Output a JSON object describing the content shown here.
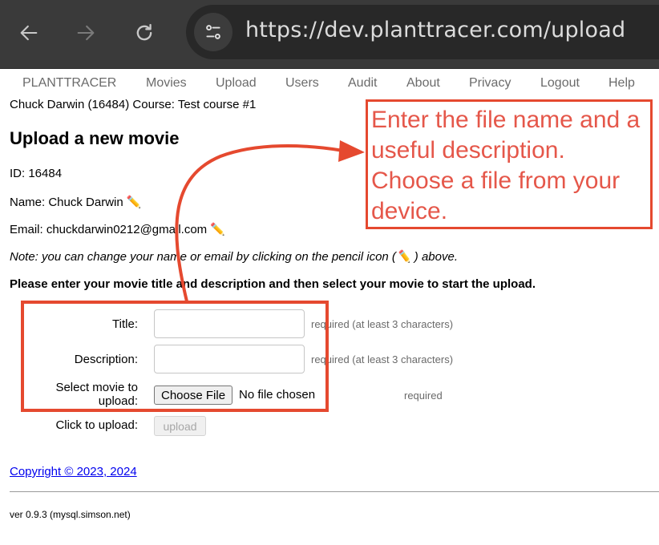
{
  "browser": {
    "url": "https://dev.planttracer.com/upload",
    "icons": {
      "back": "arrow-left-icon",
      "forward": "arrow-right-icon",
      "reload": "reload-icon",
      "site_info": "tune-icon"
    }
  },
  "nav": {
    "items": [
      {
        "label": "PLANTTRACER"
      },
      {
        "label": "Movies"
      },
      {
        "label": "Upload"
      },
      {
        "label": "Users"
      },
      {
        "label": "Audit"
      },
      {
        "label": "About"
      },
      {
        "label": "Privacy"
      },
      {
        "label": "Logout"
      },
      {
        "label": "Help"
      }
    ]
  },
  "user_line": "Chuck Darwin (16484) Course: Test course #1",
  "page": {
    "title": "Upload a new movie",
    "id_line": "ID: 16484",
    "name_line": "Name: Chuck Darwin",
    "email_line": "Email: chuckdarwin0212@gmail.com",
    "pencil": "✏️",
    "note_prefix": "Note: you can change your name or email by clicking on the pencil icon (",
    "note_suffix": " ) above.",
    "instructions": "Please enter your movie title and description and then select your movie to start the upload."
  },
  "form": {
    "title_label": "Title:",
    "title_value": "",
    "title_hint": "required (at least 3 characters)",
    "description_label": "Description:",
    "description_value": "",
    "description_hint": "required (at least 3 characters)",
    "file_label_line1": "Select movie to",
    "file_label_line2": "upload:",
    "choose_file_label": "Choose File",
    "file_status": "No file chosen",
    "file_hint": "required",
    "click_label": "Click to upload:",
    "upload_label": "upload"
  },
  "footer": {
    "copyright": "Copyright © 2023, 2024",
    "version": "ver 0.9.3 (mysql.simson.net)"
  },
  "annotation": {
    "callout_text": "Enter the file name and a useful description. Choose a file from your device.",
    "color": "#e5492f"
  }
}
